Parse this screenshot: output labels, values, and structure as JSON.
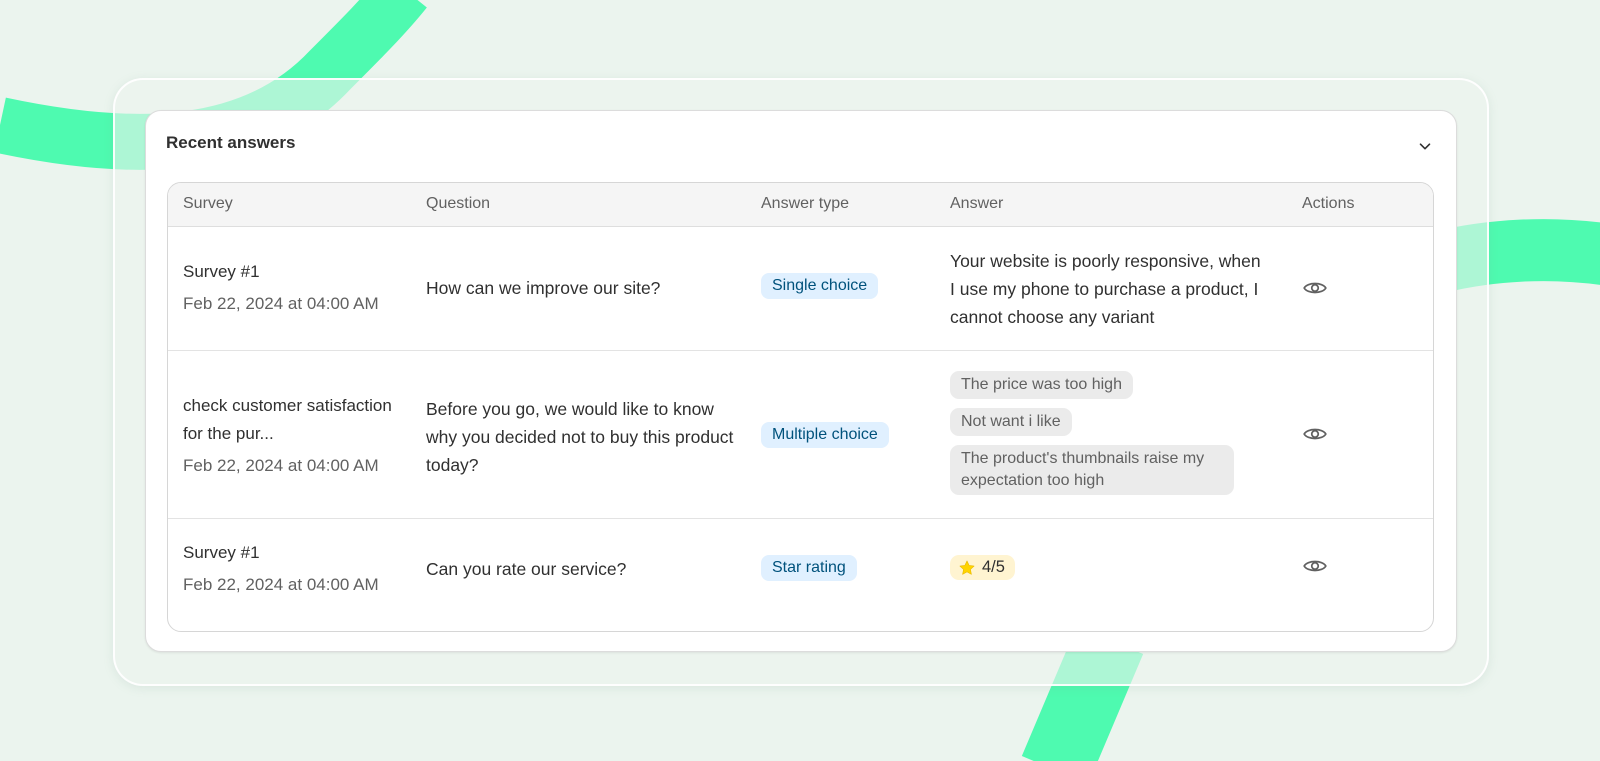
{
  "panel": {
    "title": "Recent answers",
    "collapse_icon": "chevron-down-icon"
  },
  "table": {
    "headers": [
      "Survey",
      "Question",
      "Answer type",
      "Answer",
      "Actions"
    ],
    "rows": [
      {
        "survey": "Survey #1",
        "date": "Feb 22, 2024 at 04:00 AM",
        "question": "How can we improve our site?",
        "answer_type": "Single choice",
        "answer": "Your website is poorly responsive, when I use my phone to purchase a product, I cannot choose any variant",
        "action_icon": "eye-icon"
      },
      {
        "survey": "check customer satisfaction for the pur...",
        "date": "Feb 22, 2024 at 04:00 AM",
        "question": "Before you go, we would like to know why you decided not to buy this product today?",
        "answer_type": "Multiple choice",
        "answers": [
          "The price was too high",
          "Not want i like",
          "The product's thumbnails raise my expectation too high"
        ],
        "action_icon": "eye-icon"
      },
      {
        "survey": "Survey #1",
        "date": "Feb 22, 2024 at 04:00 AM",
        "question": "Can you rate our service?",
        "answer_type": "Star rating",
        "rating": "4/5",
        "rating_value": 4,
        "rating_max": 5,
        "action_icon": "eye-icon"
      }
    ]
  },
  "colors": {
    "background": "#ebf4ee",
    "decoration": "#4efab0",
    "badge_bg": "#e0f0ff",
    "badge_text": "#00527c",
    "chip_bg": "#ebebeb",
    "star_chip_bg": "#fff4d1",
    "star": "#ffd400"
  }
}
